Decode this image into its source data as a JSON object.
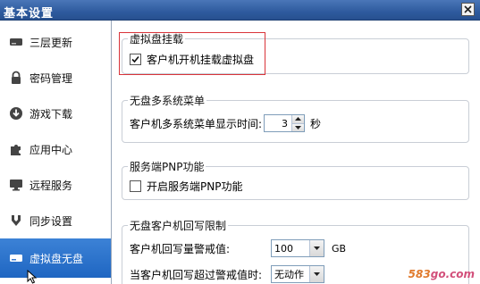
{
  "window": {
    "title": "基本设置",
    "close_label": "×"
  },
  "sidebar": {
    "items": [
      {
        "label": "三层更新",
        "icon": "drive-icon"
      },
      {
        "label": "密码管理",
        "icon": "lock-icon"
      },
      {
        "label": "游戏下载",
        "icon": "download-icon"
      },
      {
        "label": "应用中心",
        "icon": "puzzle-icon"
      },
      {
        "label": "远程服务",
        "icon": "monitor-icon"
      },
      {
        "label": "同步设置",
        "icon": "sync-icon"
      },
      {
        "label": "虚拟盘无盘",
        "icon": "disk-icon",
        "active": true
      }
    ]
  },
  "groups": {
    "virtual_disk": {
      "title": "虚拟盘挂载",
      "checkbox_label": "客户机开机挂载虚拟盘",
      "checked": true
    },
    "multi_menu": {
      "title": "无盘多系统菜单",
      "label": "客户机多系统菜单显示时间:",
      "value": "3",
      "unit": "秒"
    },
    "pnp": {
      "title": "服务端PNP功能",
      "checkbox_label": "开启服务端PNP功能",
      "checked": false
    },
    "write_limit": {
      "title": "无盘客户机回写限制",
      "warn_label": "客户机回写量警戒值:",
      "warn_value": "100",
      "warn_unit": "GB",
      "action_label": "当客户机回写超过警戒值时:",
      "action_value": "无动作"
    }
  },
  "watermark": {
    "text": "583go.com",
    "prefix": "583",
    "suffix": "go.com"
  },
  "colors": {
    "accent": "#1f66c2",
    "title_bar": "#2e5b9e",
    "highlight": "#d9343a"
  }
}
